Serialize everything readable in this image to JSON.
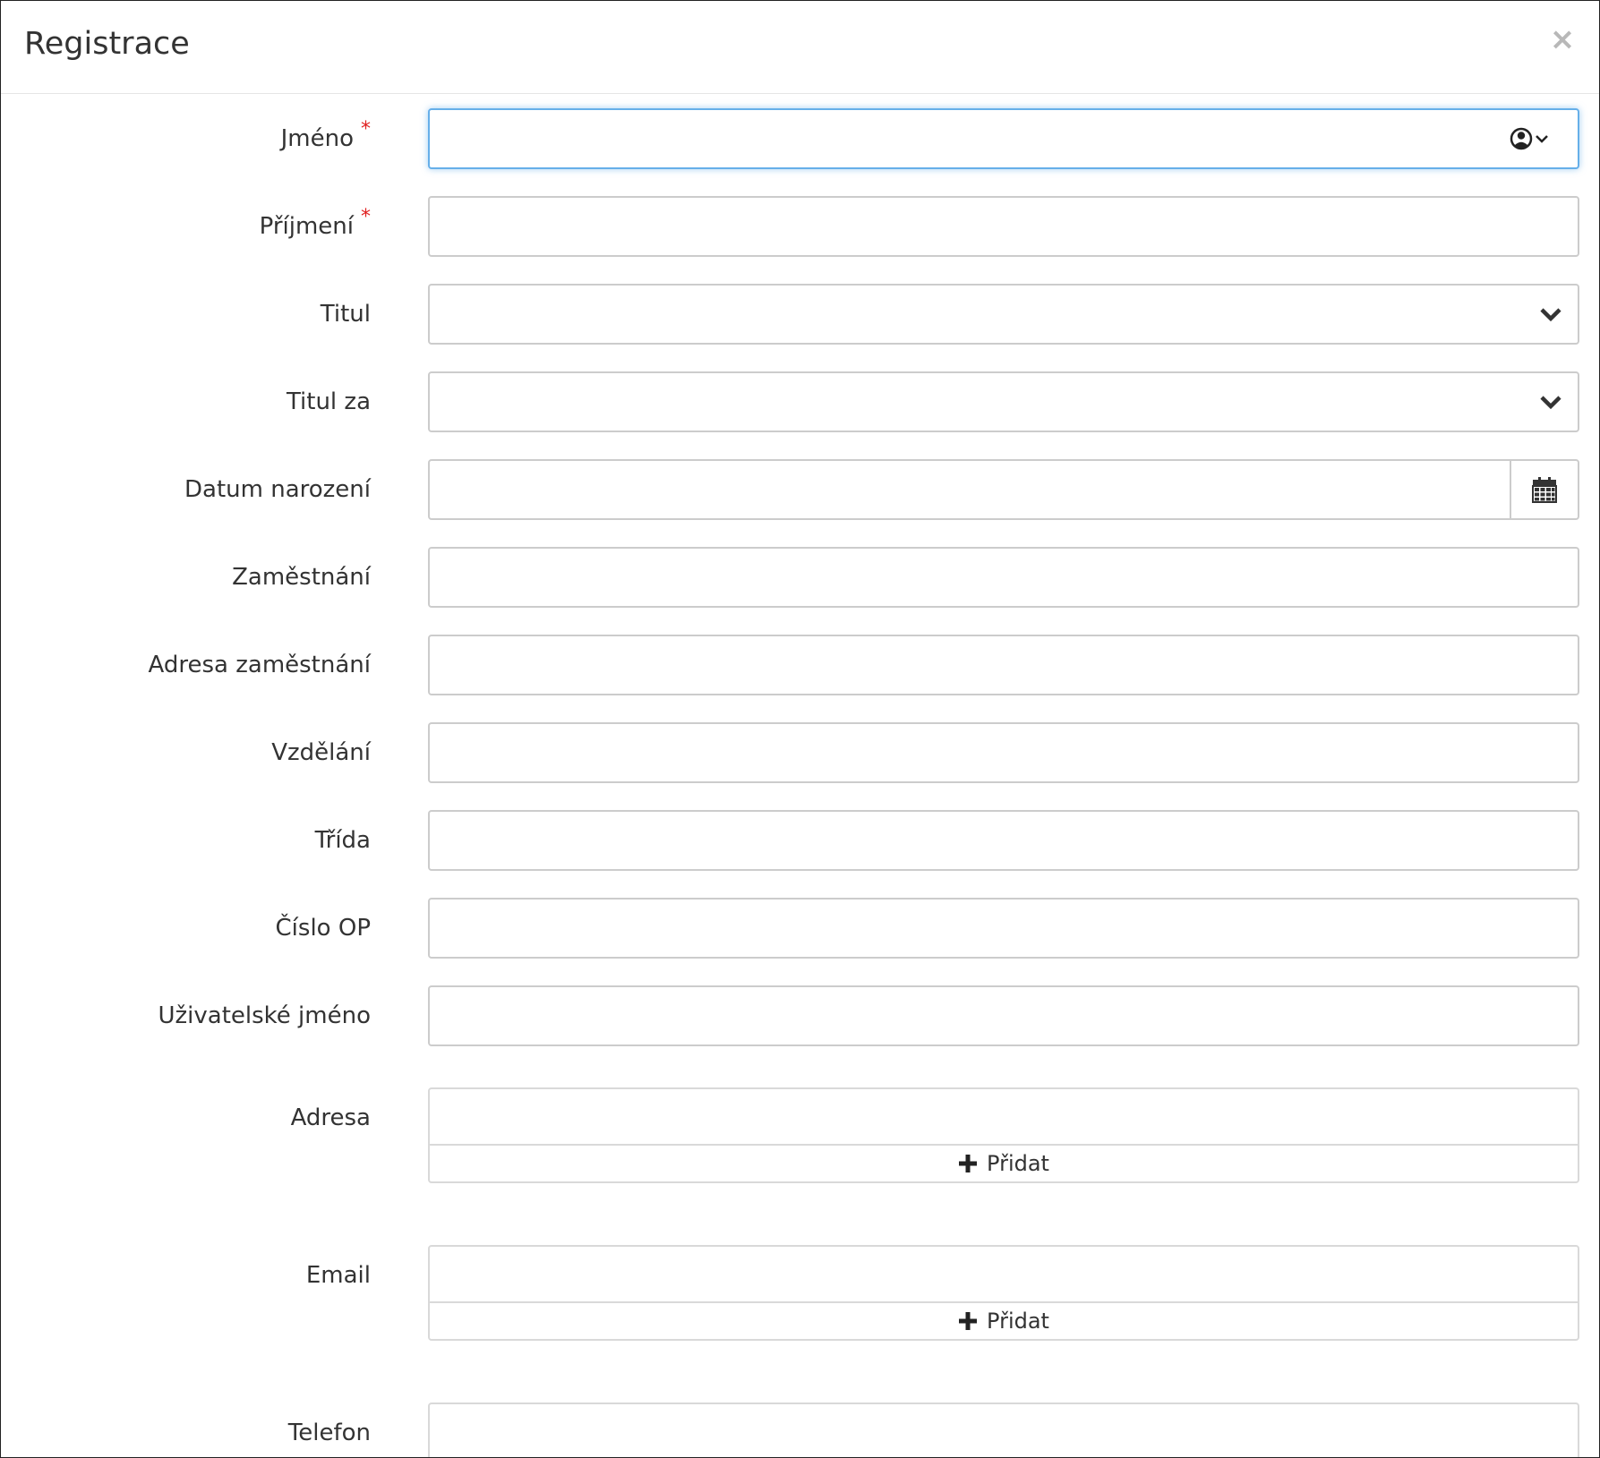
{
  "modal": {
    "title": "Registrace",
    "close_label": "×"
  },
  "fields": {
    "jmeno": {
      "label": "Jméno",
      "required_mark": "*",
      "value": ""
    },
    "prijmeni": {
      "label": "Příjmení",
      "required_mark": "*",
      "value": ""
    },
    "titul": {
      "label": "Titul",
      "value": ""
    },
    "titul_za": {
      "label": "Titul za",
      "value": ""
    },
    "datum_narozeni": {
      "label": "Datum narození",
      "value": ""
    },
    "zamestnani": {
      "label": "Zaměstnání",
      "value": ""
    },
    "adresa_zamestnani": {
      "label": "Adresa zaměstnání",
      "value": ""
    },
    "vzdelani": {
      "label": "Vzdělání",
      "value": ""
    },
    "trida": {
      "label": "Třída",
      "value": ""
    },
    "cislo_op": {
      "label": "Číslo OP",
      "value": ""
    },
    "uzivatelske_jmeno": {
      "label": "Uživatelské jméno",
      "value": ""
    },
    "adresa": {
      "label": "Adresa",
      "add_label": "Přidat"
    },
    "email": {
      "label": "Email",
      "add_label": "Přidat"
    },
    "telefon": {
      "label": "Telefon",
      "value": ""
    }
  },
  "icons": {
    "close": "close-icon",
    "contact_picker": "user-circle-icon",
    "select_arrow": "chevron-down-icon",
    "calendar": "calendar-icon",
    "add": "plus-icon"
  },
  "colors": {
    "focus_border": "#66afe9",
    "required": "#e02020",
    "border": "#cccccc"
  }
}
